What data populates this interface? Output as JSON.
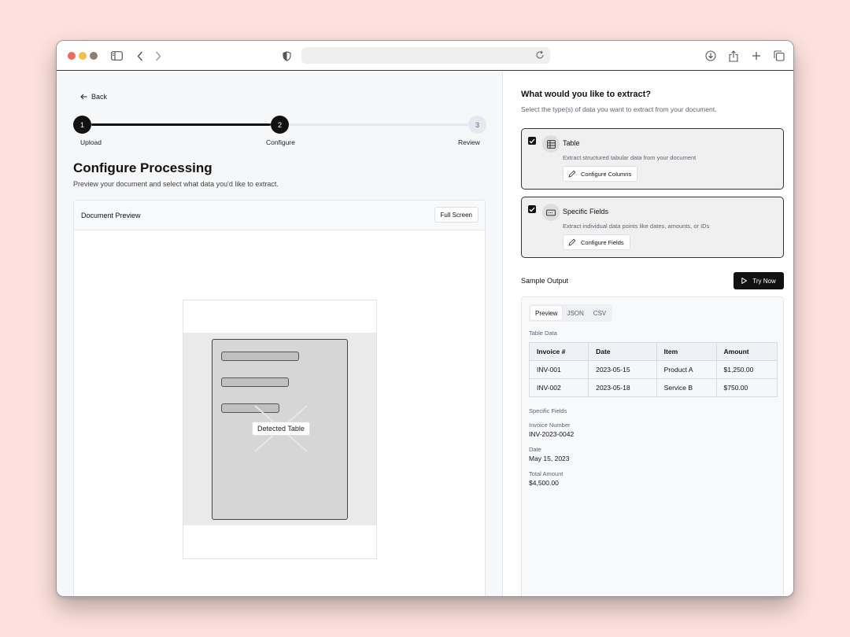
{
  "left": {
    "back_label": "Back",
    "steps": [
      {
        "number": "1",
        "label": "Upload",
        "state": "done"
      },
      {
        "number": "2",
        "label": "Configure",
        "state": "done"
      },
      {
        "number": "3",
        "label": "Review",
        "state": "todo"
      }
    ],
    "title": "Configure Processing",
    "subtitle": "Preview your document and select what data you'd like to extract.",
    "preview": {
      "title": "Document Preview",
      "fullscreen_label": "Full Screen",
      "detected_label": "Detected Table"
    }
  },
  "right": {
    "title": "What would you like to extract?",
    "subtitle": "Select the type(s) of data you want to extract from your document.",
    "options": [
      {
        "title": "Table",
        "description": "Extract structured tabular data from your document",
        "button": "Configure Columns",
        "checked": true,
        "icon": "table-icon"
      },
      {
        "title": "Specific Fields",
        "description": "Extract individual data points like dates, amounts, or IDs",
        "button": "Configure Fields",
        "checked": true,
        "icon": "form-field-icon"
      }
    ],
    "sample_output_label": "Sample Output",
    "try_now_label": "Try Now",
    "tabs": [
      "Preview",
      "JSON",
      "CSV"
    ],
    "active_tab": "Preview",
    "table_data_label": "Table Data",
    "table": {
      "headers": [
        "Invoice #",
        "Date",
        "Item",
        "Amount"
      ],
      "rows": [
        [
          "INV-001",
          "2023-05-15",
          "Product A",
          "$1,250.00"
        ],
        [
          "INV-002",
          "2023-05-18",
          "Service B",
          "$750.00"
        ]
      ]
    },
    "specific_fields_label": "Specific Fields",
    "fields": [
      {
        "label": "Invoice Number",
        "value": "INV-2023-0042"
      },
      {
        "label": "Date",
        "value": "May 15, 2023"
      },
      {
        "label": "Total Amount",
        "value": "$4,500.00"
      }
    ]
  },
  "colors": {
    "background": "#fde1dd",
    "accent": "#111111",
    "step_inactive": "#e4e9f0"
  }
}
